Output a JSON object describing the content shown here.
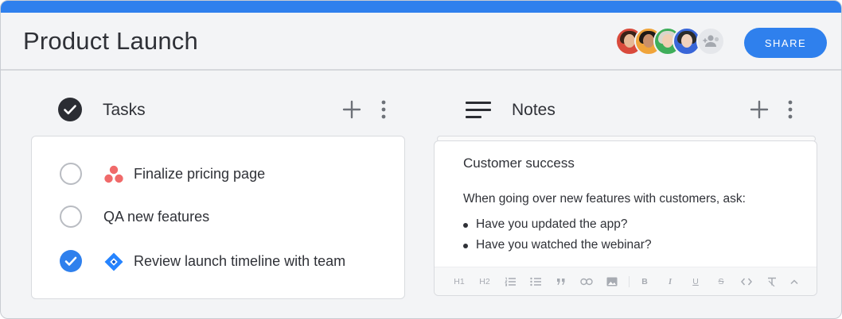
{
  "header": {
    "title": "Product Launch",
    "share_label": "SHARE",
    "accent_color": "#2f80ed"
  },
  "avatars": [
    {
      "name": "avatar-1",
      "bg": "#d94a3c"
    },
    {
      "name": "avatar-2",
      "bg": "#f0a43a"
    },
    {
      "name": "avatar-3",
      "bg": "#3fae5a"
    },
    {
      "name": "avatar-4",
      "bg": "#3966d8"
    },
    {
      "name": "add-member",
      "icon": "add-person-icon"
    }
  ],
  "tasks_column": {
    "label": "Tasks",
    "icon": "check-circle-icon",
    "items": [
      {
        "text": "Finalize pricing page",
        "done": false,
        "app_icon": "asana-icon"
      },
      {
        "text": "QA new features",
        "done": false,
        "app_icon": null
      },
      {
        "text": "Review launch timeline with team",
        "done": true,
        "app_icon": "jira-icon"
      }
    ]
  },
  "notes_column": {
    "label": "Notes",
    "icon": "notes-lines-icon",
    "note": {
      "title": "Customer success",
      "body": "When going over new features with customers, ask:",
      "bullets": [
        "Have you updated the app?",
        "Have you watched the webinar?"
      ]
    },
    "toolbar": [
      "H1",
      "H2",
      "ordered-list-icon",
      "bullet-list-icon",
      "quote-icon",
      "link-icon",
      "image-icon",
      "B",
      "I",
      "U",
      "S",
      "code-icon",
      "clear-format-icon",
      "collapse-icon"
    ]
  }
}
